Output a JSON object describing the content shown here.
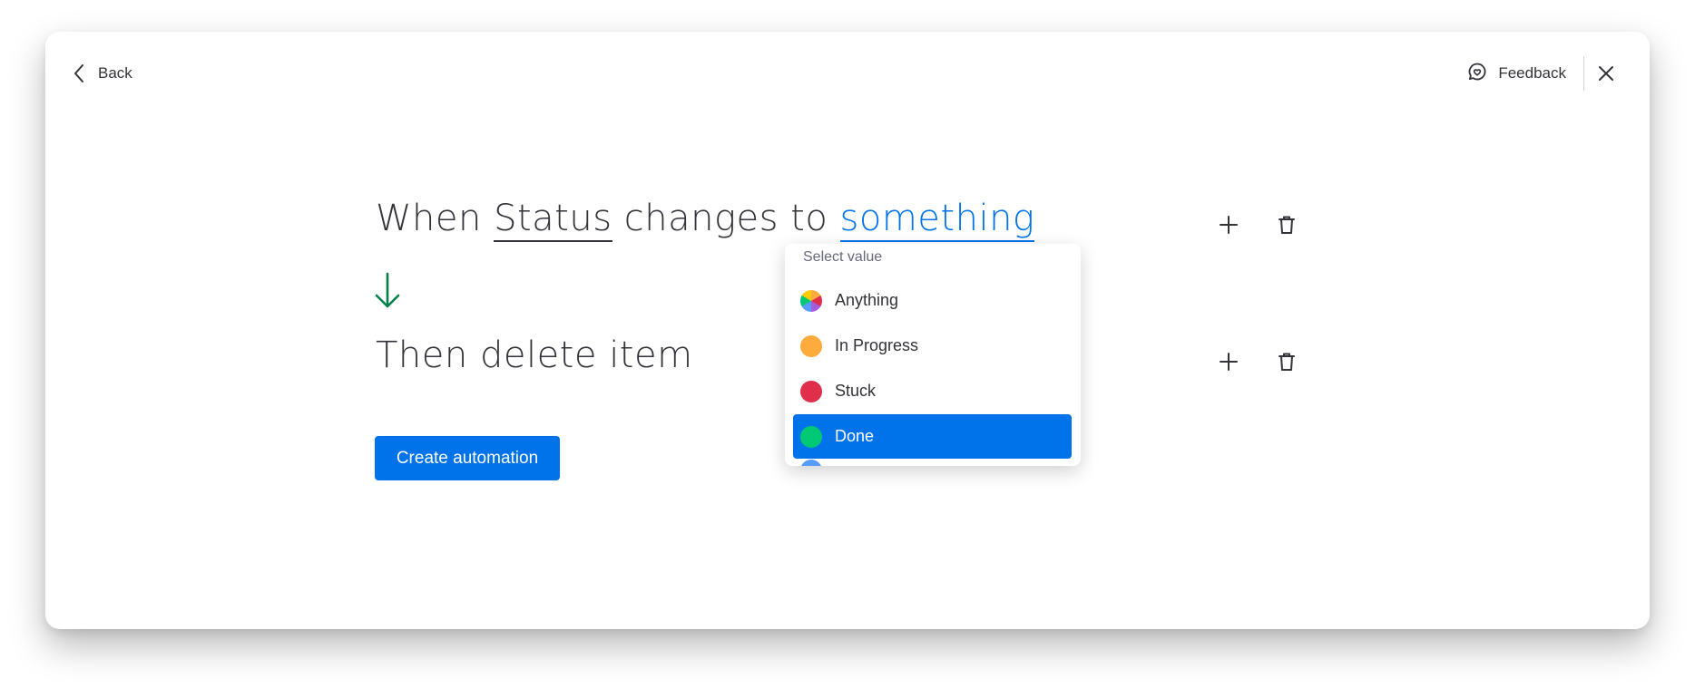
{
  "header": {
    "back_label": "Back",
    "feedback_label": "Feedback"
  },
  "recipe": {
    "trigger": {
      "prefix": "When",
      "field": "Status",
      "middle": "changes to",
      "value": "something"
    },
    "action": {
      "text": "Then delete item"
    },
    "create_label": "Create automation"
  },
  "dropdown": {
    "label": "Select value",
    "options": [
      {
        "label": "Anything",
        "color": "conic",
        "selected": false
      },
      {
        "label": "In Progress",
        "color": "#fdab3d",
        "selected": false
      },
      {
        "label": "Stuck",
        "color": "#df2f4a",
        "selected": false
      },
      {
        "label": "Done",
        "color": "#00c875",
        "selected": true
      }
    ],
    "next_option_color": "#579bfc"
  },
  "colors": {
    "accent": "#0073ea",
    "arrow": "#037f4c",
    "text": "#323338"
  }
}
